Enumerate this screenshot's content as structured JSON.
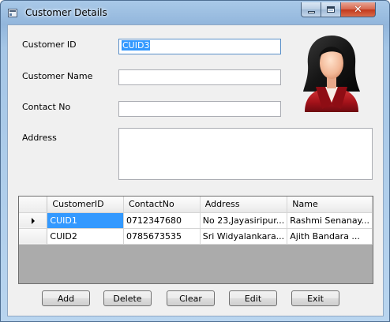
{
  "window": {
    "title": "Customer Details"
  },
  "form": {
    "customer_id_label": "Customer ID",
    "customer_id_value": "CUID3",
    "customer_name_label": "Customer Name",
    "customer_name_value": "",
    "contact_no_label": "Contact No",
    "contact_no_value": "",
    "address_label": "Address",
    "address_value": ""
  },
  "grid": {
    "columns": [
      "CustomerID",
      "ContactNo",
      "Address",
      "Name"
    ],
    "rows": [
      [
        "CUID1",
        "0712347680",
        "No 23,Jayasiripur...",
        "Rashmi Senanay..."
      ],
      [
        "CUID2",
        "0785673535",
        "Sri Widyalankara...",
        "Ajith Bandara    ..."
      ]
    ]
  },
  "buttons": {
    "add": "Add",
    "delete": "Delete",
    "clear": "Clear",
    "edit": "Edit",
    "exit": "Exit"
  },
  "icons": {
    "app": "form-icon",
    "avatar": "user-avatar-icon",
    "minimize": "minimize-icon",
    "maximize": "maximize-icon",
    "close": "close-icon",
    "row_indicator": "row-pointer-icon"
  },
  "colors": {
    "selection": "#3399ff",
    "title_bar": "#a9c9e8",
    "close_button": "#c2381c",
    "form_bg": "#f0f0f0",
    "grid_bg": "#ababab"
  }
}
